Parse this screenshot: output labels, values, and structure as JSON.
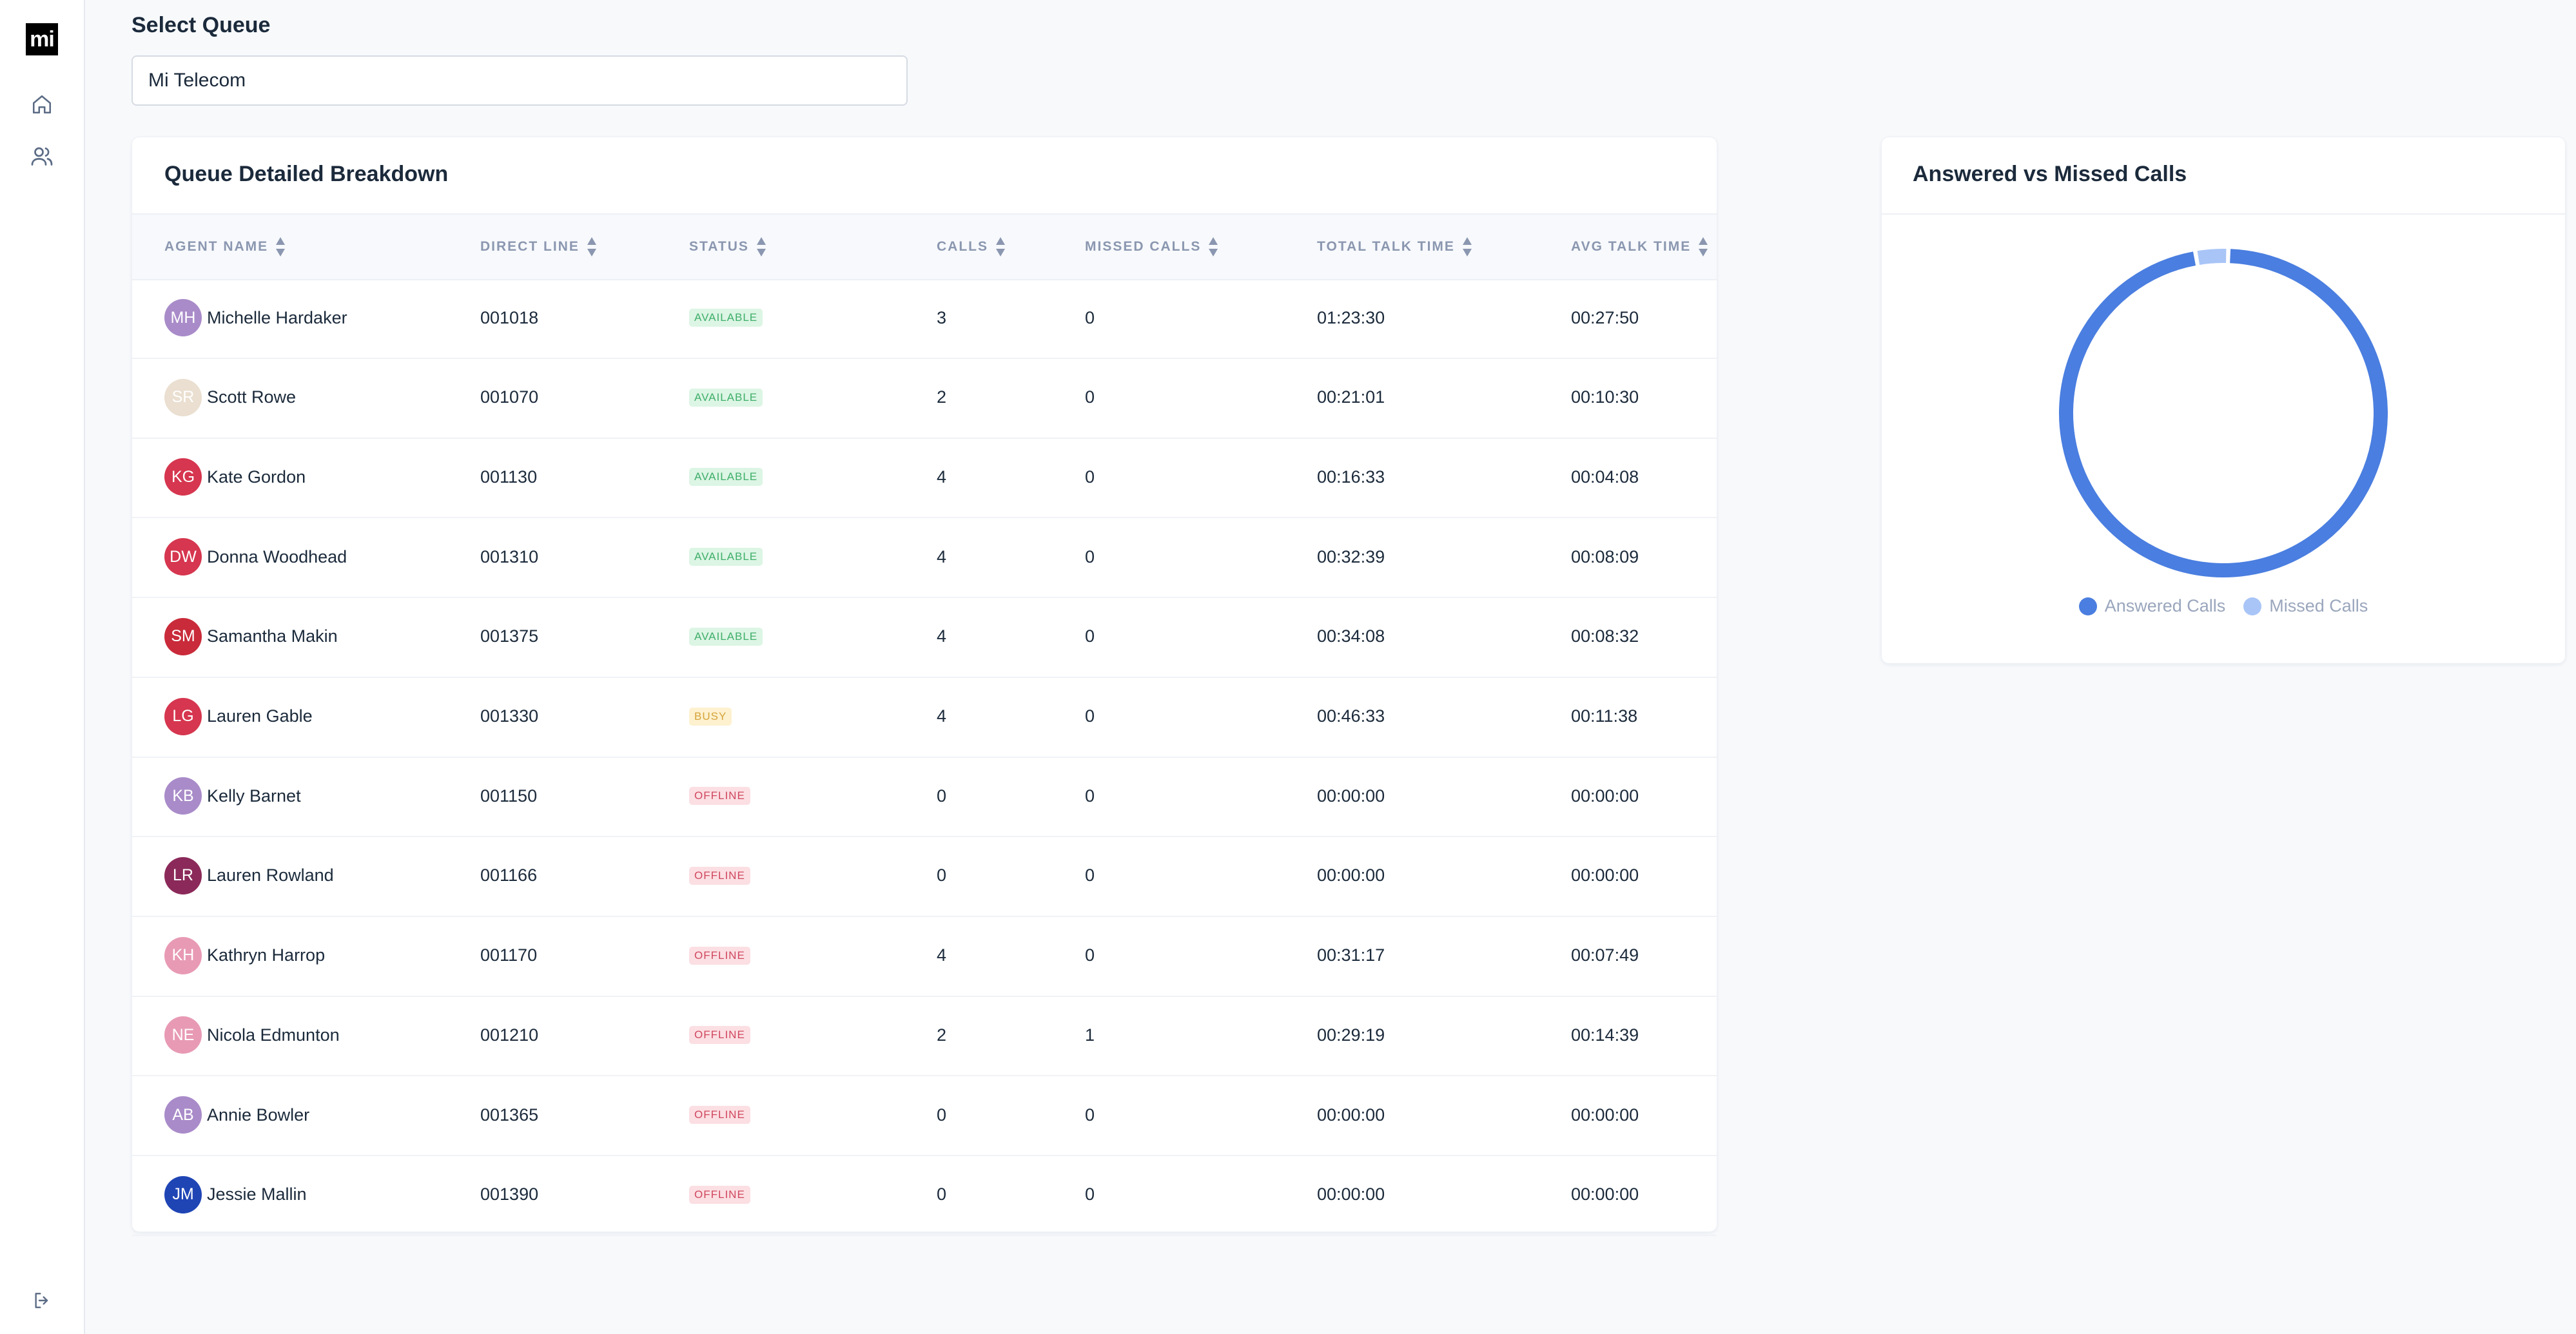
{
  "app": {
    "logo_text": "mi",
    "nav": [
      {
        "icon": "home-icon"
      },
      {
        "icon": "users-icon"
      }
    ],
    "logout_icon": "logout-icon"
  },
  "queue": {
    "label": "Select Queue",
    "selected": "Mi Telecom"
  },
  "table": {
    "title": "Queue Detailed Breakdown",
    "columns": [
      "AGENT NAME",
      "DIRECT LINE",
      "STATUS",
      "CALLS",
      "MISSED CALLS",
      "TOTAL TALK TIME",
      "AVG TALK TIME"
    ],
    "rows": [
      {
        "initials": "MH",
        "name": "Michelle Hardaker",
        "line": "001018",
        "status": "AVAILABLE",
        "calls": "3",
        "missed": "0",
        "total": "01:23:30",
        "avg": "00:27:50",
        "avatar_color": "#a98bc9"
      },
      {
        "initials": "SR",
        "name": "Scott Rowe",
        "line": "001070",
        "status": "AVAILABLE",
        "calls": "2",
        "missed": "0",
        "total": "00:21:01",
        "avg": "00:10:30",
        "avatar_color": "#eadfd0"
      },
      {
        "initials": "KG",
        "name": "Kate Gordon",
        "line": "001130",
        "status": "AVAILABLE",
        "calls": "4",
        "missed": "0",
        "total": "00:16:33",
        "avg": "00:04:08",
        "avatar_color": "#d6364f"
      },
      {
        "initials": "DW",
        "name": "Donna Woodhead",
        "line": "001310",
        "status": "AVAILABLE",
        "calls": "4",
        "missed": "0",
        "total": "00:32:39",
        "avg": "00:08:09",
        "avatar_color": "#d6364f"
      },
      {
        "initials": "SM",
        "name": "Samantha Makin",
        "line": "001375",
        "status": "AVAILABLE",
        "calls": "4",
        "missed": "0",
        "total": "00:34:08",
        "avg": "00:08:32",
        "avatar_color": "#c92b3a"
      },
      {
        "initials": "LG",
        "name": "Lauren Gable",
        "line": "001330",
        "status": "BUSY",
        "calls": "4",
        "missed": "0",
        "total": "00:46:33",
        "avg": "00:11:38",
        "avatar_color": "#d6364f"
      },
      {
        "initials": "KB",
        "name": "Kelly Barnet",
        "line": "001150",
        "status": "OFFLINE",
        "calls": "0",
        "missed": "0",
        "total": "00:00:00",
        "avg": "00:00:00",
        "avatar_color": "#a98bc9"
      },
      {
        "initials": "LR",
        "name": "Lauren Rowland",
        "line": "001166",
        "status": "OFFLINE",
        "calls": "0",
        "missed": "0",
        "total": "00:00:00",
        "avg": "00:00:00",
        "avatar_color": "#8b2a5a"
      },
      {
        "initials": "KH",
        "name": "Kathryn Harrop",
        "line": "001170",
        "status": "OFFLINE",
        "calls": "4",
        "missed": "0",
        "total": "00:31:17",
        "avg": "00:07:49",
        "avatar_color": "#e89ab5"
      },
      {
        "initials": "NE",
        "name": "Nicola Edmunton",
        "line": "001210",
        "status": "OFFLINE",
        "calls": "2",
        "missed": "1",
        "total": "00:29:19",
        "avg": "00:14:39",
        "avatar_color": "#e89ab5"
      },
      {
        "initials": "AB",
        "name": "Annie Bowler",
        "line": "001365",
        "status": "OFFLINE",
        "calls": "0",
        "missed": "0",
        "total": "00:00:00",
        "avg": "00:00:00",
        "avatar_color": "#a98bc9"
      },
      {
        "initials": "JM",
        "name": "Jessie Mallin",
        "line": "001390",
        "status": "OFFLINE",
        "calls": "0",
        "missed": "0",
        "total": "00:00:00",
        "avg": "00:00:00",
        "avatar_color": "#1f45b5"
      }
    ],
    "status_styles": {
      "AVAILABLE": {
        "bg": "#dcf5e4",
        "fg": "#3fae6a"
      },
      "BUSY": {
        "bg": "#fdf1cf",
        "fg": "#d6a23a"
      },
      "OFFLINE": {
        "bg": "#fbdfe3",
        "fg": "#d0475e"
      }
    }
  },
  "chart": {
    "title": "Answered vs Missed Calls",
    "chart_data": {
      "type": "pie",
      "categories": [
        "Answered Calls",
        "Missed Calls"
      ],
      "values": [
        30,
        1
      ],
      "colors": [
        "#4a7ee0",
        "#a9c5f7"
      ],
      "legend": "bottom"
    }
  }
}
